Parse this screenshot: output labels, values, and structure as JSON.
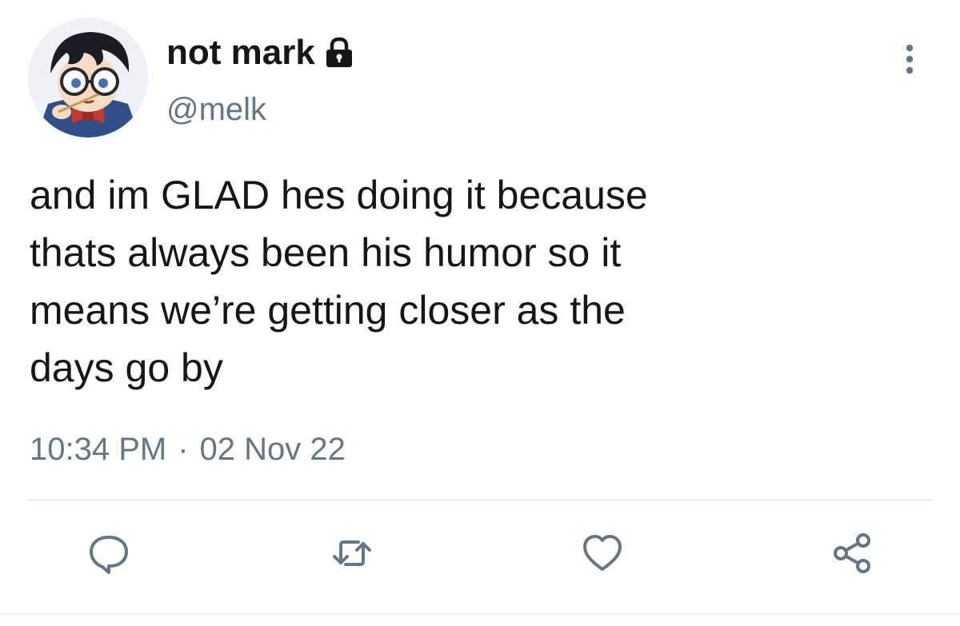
{
  "user": {
    "display_name": "not mark",
    "handle": "@melk",
    "protected": true
  },
  "tweet": {
    "text": "and im GLAD hes doing it because\nthats always been his humor so it\nmeans we’re getting closer as the\ndays go by",
    "time": "10:34 PM",
    "separator": "·",
    "date": "02 Nov 22"
  },
  "icons": {
    "lock": "lock-icon",
    "more": "more-vertical-icon",
    "reply": "reply-icon",
    "retweet": "retweet-icon",
    "like": "heart-icon",
    "share": "share-icon"
  },
  "colors": {
    "text": "#14171a",
    "secondary": "#657786",
    "divider": "#e6ecf0"
  }
}
